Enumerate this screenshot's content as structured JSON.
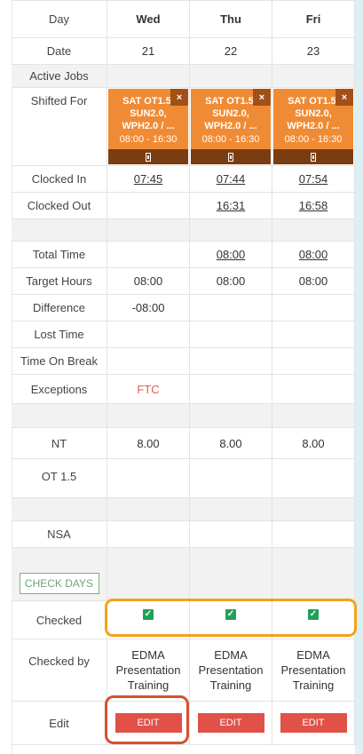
{
  "table": {
    "rows": {
      "day": {
        "label": "Day",
        "values": [
          "Wed",
          "Thu",
          "Fri"
        ]
      },
      "date": {
        "label": "Date",
        "values": [
          "21",
          "22",
          "23"
        ]
      },
      "active_jobs": {
        "label": "Active Jobs"
      },
      "shifted_for": {
        "label": "Shifted For",
        "cards": [
          {
            "title": "SAT OT1.5, SUN2.0, WPH2.0 / ...",
            "time": "08:00 - 16:30",
            "close": "×"
          },
          {
            "title": "SAT OT1.5, SUN2.0, WPH2.0 / ...",
            "time": "08:00 - 16:30",
            "close": "×"
          },
          {
            "title": "SAT OT1.5, SUN2.0, WPH2.0 / ...",
            "time": "08:00 - 16:30",
            "close": "×"
          }
        ]
      },
      "clocked_in": {
        "label": "Clocked In",
        "values": [
          "07:45",
          "07:44",
          "07:54"
        ]
      },
      "clocked_out": {
        "label": "Clocked Out",
        "values": [
          "",
          "16:31",
          "16:58"
        ]
      },
      "total_time": {
        "label": "Total Time",
        "values": [
          "",
          "08:00",
          "08:00"
        ]
      },
      "target_hours": {
        "label": "Target Hours",
        "values": [
          "08:00",
          "08:00",
          "08:00"
        ]
      },
      "difference": {
        "label": "Difference",
        "values": [
          "-08:00",
          "",
          ""
        ]
      },
      "lost_time": {
        "label": "Lost Time",
        "values": [
          "",
          "",
          ""
        ]
      },
      "time_on_break": {
        "label": "Time On Break",
        "values": [
          "",
          "",
          ""
        ]
      },
      "exceptions": {
        "label": "Exceptions",
        "values": [
          "FTC",
          "",
          ""
        ]
      },
      "nt": {
        "label": "NT",
        "values": [
          "8.00",
          "8.00",
          "8.00"
        ]
      },
      "ot15": {
        "label": "OT 1.5",
        "values": [
          "",
          "",
          ""
        ]
      },
      "nsa": {
        "label": "NSA",
        "values": [
          "",
          "",
          ""
        ]
      },
      "check_days": {
        "button": "CHECK DAYS"
      },
      "checked": {
        "label": "Checked",
        "values": [
          true,
          true,
          true
        ],
        "checkmark": "✓"
      },
      "checked_by": {
        "label": "Checked by",
        "values": [
          "EDMA Presentation Training",
          "EDMA Presentation Training",
          "EDMA Presentation Training"
        ]
      },
      "edit": {
        "label": "Edit",
        "button": "EDIT"
      }
    }
  },
  "colors": {
    "shift_orange": "#f08b35",
    "shift_dark": "#7a3d12",
    "edit_red": "#e15147",
    "check_green": "#21a157",
    "highlight_orange": "#f3a21a",
    "highlight_red": "#d5512f"
  }
}
